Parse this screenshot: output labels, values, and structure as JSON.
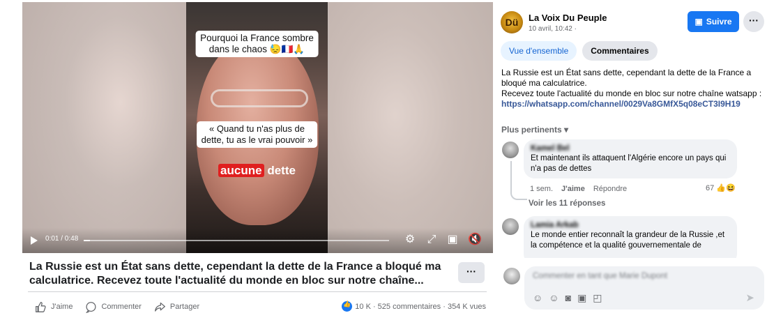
{
  "video": {
    "caption_top": "Pourquoi la France sombre",
    "caption_top_2": "dans le chaos 😓🇫🇷🙏",
    "caption_mid": "« Quand tu n'as plus de",
    "caption_mid_2": "dette, tu as le vrai pouvoir »",
    "caption_red": "aucune",
    "caption_white": "dette",
    "time": "0:01 / 0:48",
    "progress": 0.02
  },
  "post": {
    "title": "La Russie est un État sans dette, cependant la dette de la France a bloqué ma calculatrice. Recevez toute l'actualité du monde en bloc sur notre chaîne...",
    "more_label": "···",
    "like_label": "J'aime",
    "comment_label": "Commenter",
    "share_label": "Partager",
    "stats": "10 K · 525 commentaires · 354 K vues"
  },
  "page": {
    "avatar_text": "Dü",
    "name": "La Voix Du Peuple",
    "date": "10 avril, 10:42 ·",
    "follow_label": "Suivre",
    "dots": "···"
  },
  "tabs": {
    "overview": "Vue d'ensemble",
    "comments": "Commentaires"
  },
  "description": {
    "line1": "La Russie est un État sans dette, cependant la dette de la France a bloqué ma calculatrice.",
    "line2": "Recevez toute l'actualité du monde en bloc sur notre chaîne watsapp :",
    "link": "https://whatsapp.com/channel/0029Va8GMfX5q08eCT3I9H19"
  },
  "sort_label": "Plus pertinents ▾",
  "comments": [
    {
      "name": "Kamel Bel",
      "text": "Et maintenant ils attaquent l'Algérie encore un pays qui n'a pas de dettes",
      "age": "1 sem.",
      "like": "J'aime",
      "reply": "Répondre",
      "reactions": "67 👍😆",
      "replies": "Voir les 11 réponses"
    },
    {
      "name": "Lamia Arkab",
      "text": "Le monde entier reconnaît la grandeur de la Russie ,et la compétence et la qualité gouvernementale de"
    }
  ],
  "comment_input": {
    "placeholder": "Commenter en tant que Marie Dupont"
  },
  "colors": {
    "accent": "#1877f2",
    "link": "#385898"
  }
}
